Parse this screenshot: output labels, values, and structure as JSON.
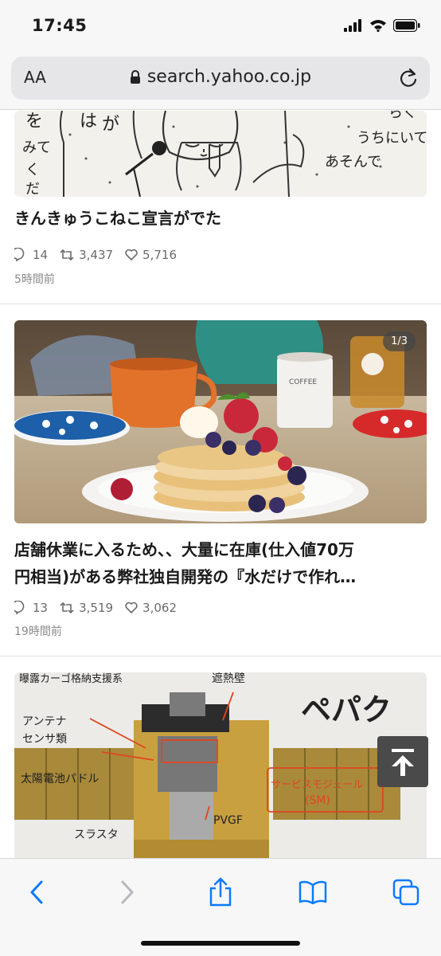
{
  "status_bar": {
    "time": "17:45"
  },
  "url_bar": {
    "aa_label": "AA",
    "url": "search.yahoo.co.jp"
  },
  "posts": [
    {
      "title": "きんきゅうこねこ宣言がでた",
      "replies": "14",
      "retweets": "3,437",
      "likes": "5,716",
      "time": "5時間前",
      "image_text": [
        "は",
        "が",
        "を",
        "みて",
        "く",
        "だ",
        "らく",
        "うちにいて",
        "あそんで"
      ]
    },
    {
      "title_line1": "店舗休業に入るため、、大量に在庫(仕入値70万",
      "title_line2": "円相当)がある弊社独自開発の『水だけで作れ…",
      "replies": "13",
      "retweets": "3,519",
      "likes": "3,062",
      "time": "19時間前",
      "image_badge": "1/3",
      "image_text": "COFFEE"
    },
    {
      "image_text": {
        "top_left": "曝露カーゴ格納支援系",
        "top_right": "遮熱壁",
        "antenna": "アンテナ",
        "sensor": "センサ類",
        "solar": "太陽電池パドル",
        "service_module": "サービスモジュール",
        "sm": "(SM)",
        "pvgf": "PVGF",
        "thruster": "スラスタ",
        "heading": "ペパク"
      }
    }
  ],
  "colors": {
    "accent": "#0a7aff",
    "text": "#1a1a1a",
    "meta": "#6b6b6b"
  }
}
